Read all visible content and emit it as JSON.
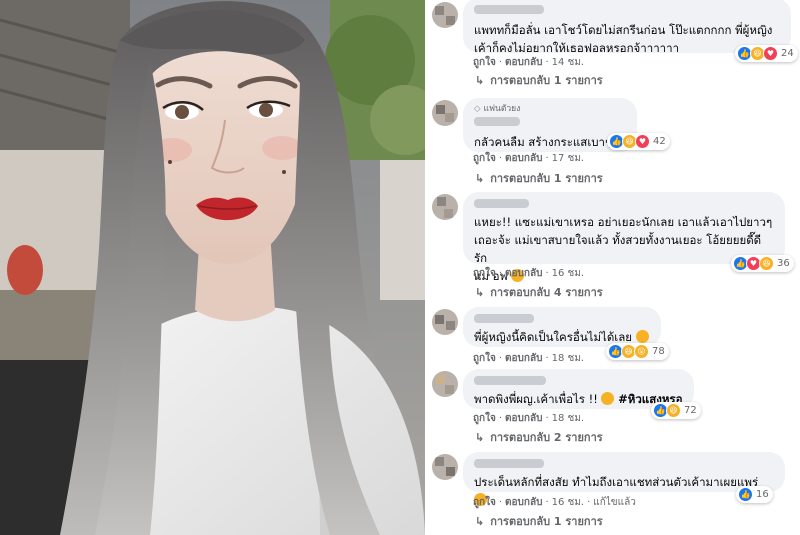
{
  "photo": {
    "description_icon": "selfie-photo"
  },
  "comments": [
    {
      "text": "แพททก็มือลั่น เอาโชว์โดยไม่สกรีนก่อน โป๊ะแตกกกก พี่ผู้หญิงเค้าก็คงไม่อยากให้เธอฟอลหรอกจ้าาาาาา",
      "line1": "แพททก็มือลั่น เอาโชว์โดยไม่สกรีนก่อน โป๊ะแตกกกก พี่ผู้หญิง",
      "line2": "เค้าก็คงไม่อยากให้เธอฟอลหรอกจ้าาาาาา",
      "like": "ถูกใจ",
      "reply": "ตอบกลับ",
      "time": "14 ชม.",
      "replies": "การตอบกลับ 1 รายการ",
      "reactions": "24"
    },
    {
      "badge": "แฟนตัวยง",
      "text": "กลัวคนลืม สร้างกระแสเบาๆ",
      "like": "ถูกใจ",
      "reply": "ตอบกลับ",
      "time": "17 ชม.",
      "replies": "การตอบกลับ 1 รายการ",
      "reactions": "42"
    },
    {
      "line1": "แหยะ!! แซะแม่เขาเหรอ อย่าเยอะนักเลย เอาแล้วเอาไปยาวๆ",
      "line2": "เถอะจ้ะ แม่เขาสบายใจแล้ว ทั้งสวยทั้งงานเยอะ โอ้ยยยยดี๊ดี รัก",
      "line3": "แม่ อฟ",
      "like": "ถูกใจ",
      "reply": "ตอบกลับ",
      "time": "16 ชม.",
      "replies": "การตอบกลับ 4 รายการ",
      "reactions": "36"
    },
    {
      "text": "พี่ผู้หญิงนี้คิดเป็นใครอื่นไม่ได้เลย",
      "like": "ถูกใจ",
      "reply": "ตอบกลับ",
      "time": "18 ชม.",
      "reactions": "78"
    },
    {
      "text": "พาดพิงพี่ผญ.เค้าเพื่อไร !!",
      "hashtag": "#หิวแสงหรอ",
      "like": "ถูกใจ",
      "reply": "ตอบกลับ",
      "time": "18 ชม.",
      "replies": "การตอบกลับ 2 รายการ",
      "reactions": "72"
    },
    {
      "text": "ประเด็นหลักที่สงสัย ทำไมถึงเอาแชทส่วนตัวเค้ามาเผยแพร่",
      "like": "ถูกใจ",
      "reply": "ตอบกลับ",
      "time": "16 ชม.",
      "edited": "แก้ไขแล้ว",
      "replies": "การตอบกลับ 1 รายการ",
      "reactions": "16"
    }
  ],
  "colors": {
    "bubble": "#f0f2f5",
    "meta": "#65676b",
    "like": "#1877f2",
    "love": "#f33e58",
    "haha": "#f7b125"
  }
}
